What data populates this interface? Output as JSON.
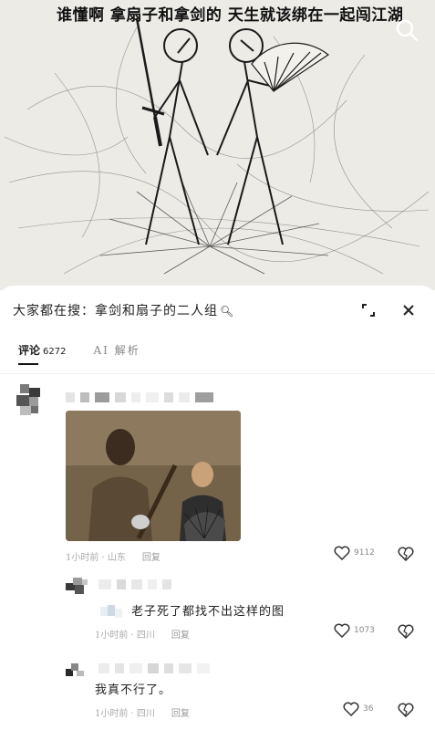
{
  "hero": {
    "caption": "谁懂啊 拿扇子和拿剑的 天生就该绑在一起闯江湖"
  },
  "sheet": {
    "search_text": "大家都在搜：拿剑和扇子的二人组"
  },
  "tabs": [
    {
      "label": "评论",
      "count": "6272"
    },
    {
      "label": "AI 解析"
    }
  ],
  "comments": [
    {
      "meta_time": "1小时前 · 山东",
      "reply_label": "回复",
      "likes": "9112"
    },
    {
      "text": "老子死了都找不出这样的图",
      "meta_time": "1小时前 · 四川",
      "reply_label": "回复",
      "likes": "1073"
    },
    {
      "text": "我真不行了。",
      "meta_time": "1小时前 · 四川",
      "reply_label": "回复",
      "likes": "36"
    }
  ],
  "colors": {
    "hero_bg": "#ecebe6",
    "sketch_line": "#2a2a2a",
    "sheet_bg": "#ffffff",
    "meta_gray": "#aaaaaa"
  }
}
